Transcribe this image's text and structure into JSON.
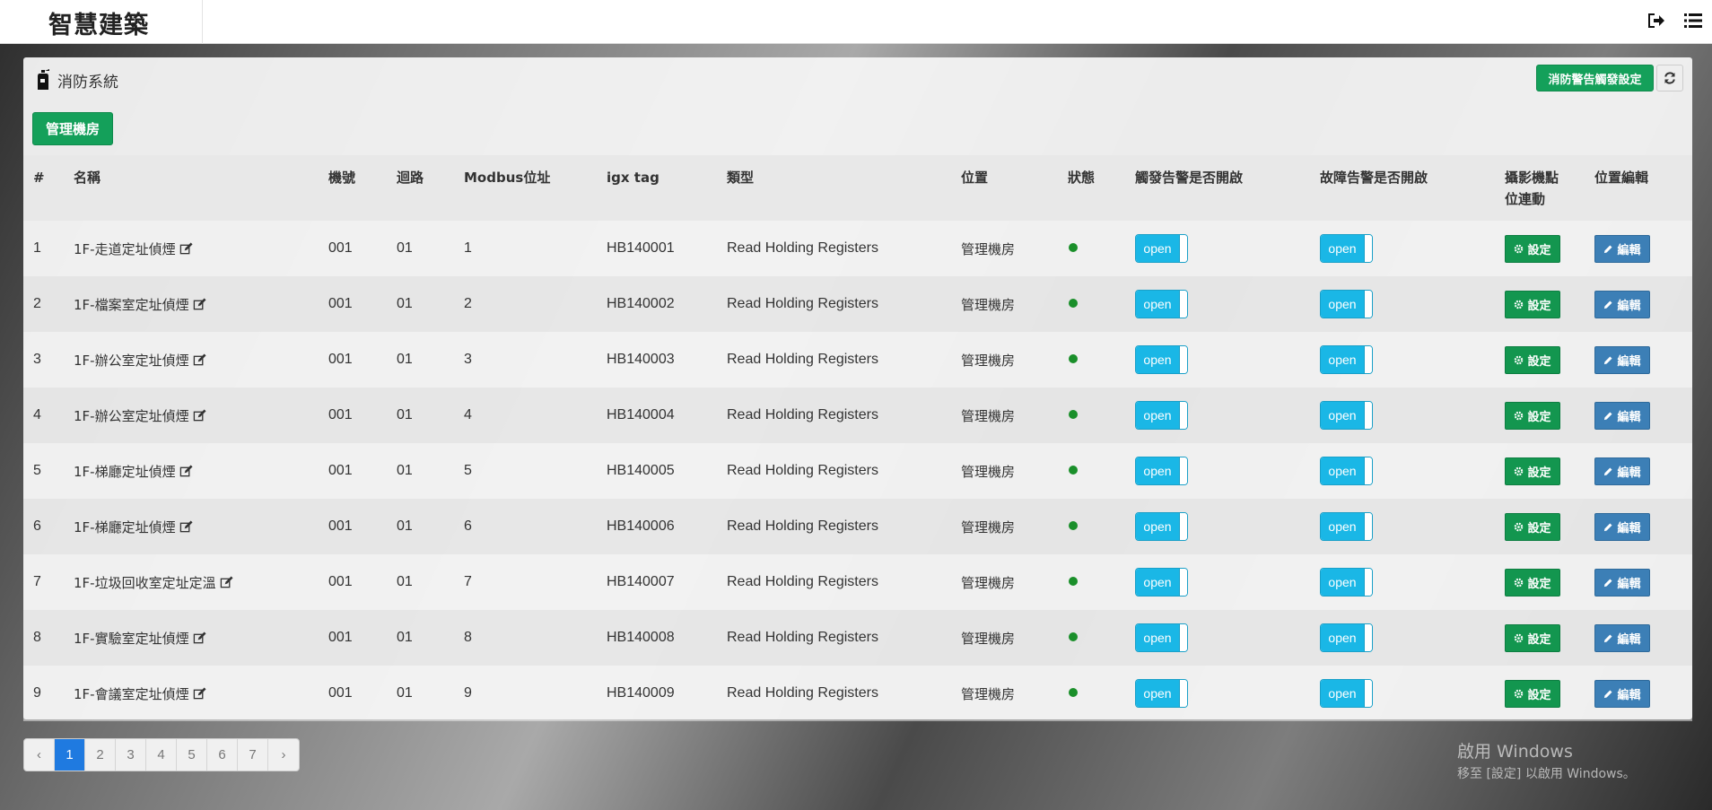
{
  "app": {
    "title": "智慧建築"
  },
  "panel": {
    "title": "消防系統",
    "alarm_button": "消防警告觸發設定",
    "room_button": "管理機房"
  },
  "table": {
    "headers": [
      "#",
      "名稱",
      "機號",
      "迴路",
      "Modbus位址",
      "igx tag",
      "類型",
      "位置",
      "狀態",
      "觸發告警是否開啟",
      "故障告警是否開啟",
      "攝影機點位連動",
      "位置編輯"
    ],
    "toggle_label": "open",
    "set_label": "設定",
    "edit_label": "編輯",
    "status_color": "#1a8f2a",
    "rows": [
      {
        "no": "1",
        "name": "1F-走道定址偵煙",
        "machine": "001",
        "loop": "01",
        "modbus": "1",
        "tag": "HB140001",
        "type": "Read Holding Registers",
        "location": "管理機房"
      },
      {
        "no": "2",
        "name": "1F-檔案室定址偵煙",
        "machine": "001",
        "loop": "01",
        "modbus": "2",
        "tag": "HB140002",
        "type": "Read Holding Registers",
        "location": "管理機房"
      },
      {
        "no": "3",
        "name": "1F-辦公室定址偵煙",
        "machine": "001",
        "loop": "01",
        "modbus": "3",
        "tag": "HB140003",
        "type": "Read Holding Registers",
        "location": "管理機房"
      },
      {
        "no": "4",
        "name": "1F-辦公室定址偵煙",
        "machine": "001",
        "loop": "01",
        "modbus": "4",
        "tag": "HB140004",
        "type": "Read Holding Registers",
        "location": "管理機房"
      },
      {
        "no": "5",
        "name": "1F-梯廳定址偵煙",
        "machine": "001",
        "loop": "01",
        "modbus": "5",
        "tag": "HB140005",
        "type": "Read Holding Registers",
        "location": "管理機房"
      },
      {
        "no": "6",
        "name": "1F-梯廳定址偵煙",
        "machine": "001",
        "loop": "01",
        "modbus": "6",
        "tag": "HB140006",
        "type": "Read Holding Registers",
        "location": "管理機房"
      },
      {
        "no": "7",
        "name": "1F-垃圾回收室定址定溫",
        "machine": "001",
        "loop": "01",
        "modbus": "7",
        "tag": "HB140007",
        "type": "Read Holding Registers",
        "location": "管理機房"
      },
      {
        "no": "8",
        "name": "1F-實驗室定址偵煙",
        "machine": "001",
        "loop": "01",
        "modbus": "8",
        "tag": "HB140008",
        "type": "Read Holding Registers",
        "location": "管理機房"
      },
      {
        "no": "9",
        "name": "1F-會議室定址偵煙",
        "machine": "001",
        "loop": "01",
        "modbus": "9",
        "tag": "HB140009",
        "type": "Read Holding Registers",
        "location": "管理機房"
      }
    ]
  },
  "pagination": {
    "prev": "‹",
    "pages": [
      "1",
      "2",
      "3",
      "4",
      "5",
      "6",
      "7"
    ],
    "next": "›",
    "current": "1"
  },
  "watermark": {
    "line1": "啟用 Windows",
    "line2": "移至 [設定] 以啟用 Windows。"
  }
}
